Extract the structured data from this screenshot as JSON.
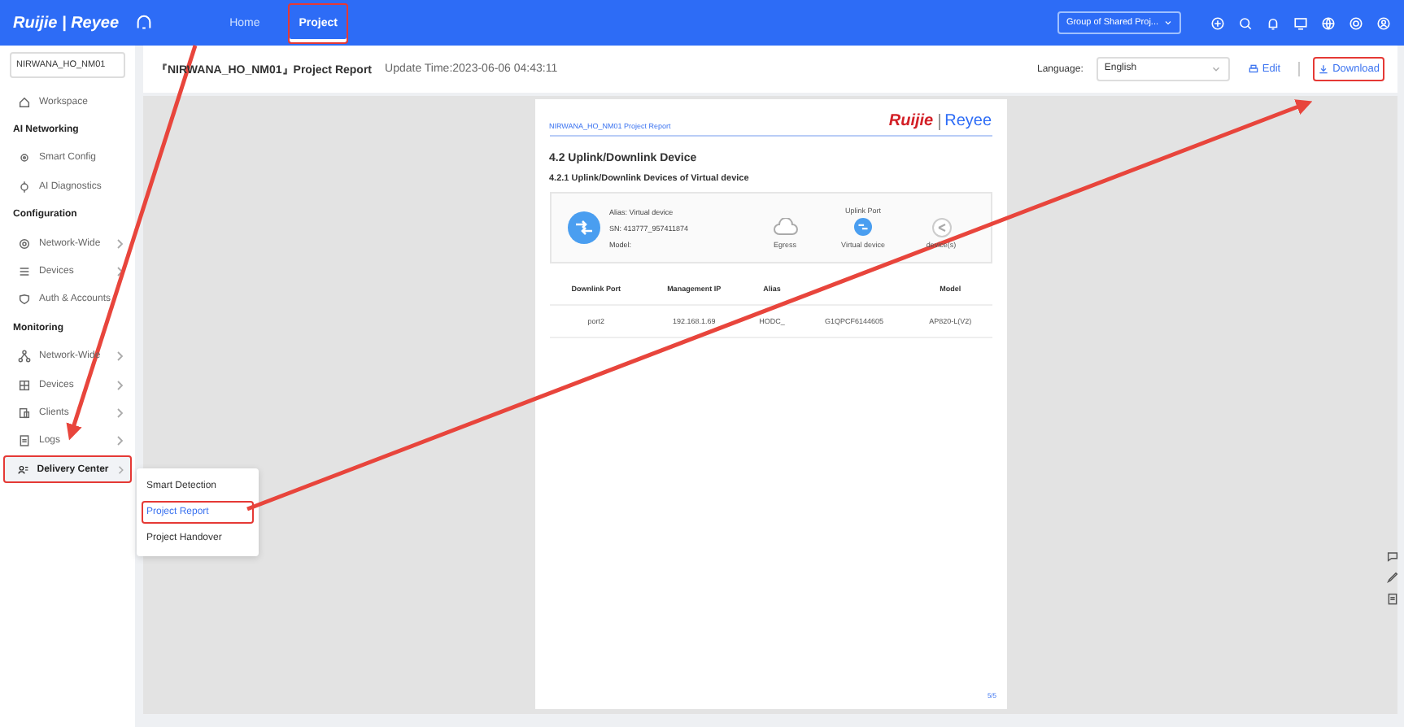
{
  "topbar": {
    "brand": "Ruijie | Reyee",
    "nav": [
      {
        "label": "Home",
        "selected": false,
        "highlighted": false
      },
      {
        "label": "Project",
        "selected": true,
        "highlighted": true
      }
    ],
    "group_select": "Group of Shared Proj..."
  },
  "sidebar": {
    "project_select": "NIRWANA_HO_NM01",
    "items": [
      {
        "kind": "item",
        "label": "Workspace",
        "selected": false,
        "highlighted": false
      },
      {
        "kind": "header",
        "label": "AI Networking"
      },
      {
        "kind": "item",
        "label": "Smart Config",
        "selected": false,
        "highlighted": false
      },
      {
        "kind": "item",
        "label": "AI Diagnostics",
        "selected": false,
        "highlighted": false
      },
      {
        "kind": "header",
        "label": "Configuration"
      },
      {
        "kind": "expandable",
        "label": "Network-Wide",
        "selected": false,
        "highlighted": false
      },
      {
        "kind": "expandable",
        "label": "Devices",
        "selected": false,
        "highlighted": false
      },
      {
        "kind": "item",
        "label": "Auth & Accounts",
        "selected": false,
        "highlighted": false
      },
      {
        "kind": "header",
        "label": "Monitoring"
      },
      {
        "kind": "expandable",
        "label": "Network-Wide",
        "selected": false,
        "highlighted": false
      },
      {
        "kind": "expandable",
        "label": "Devices",
        "selected": false,
        "highlighted": false
      },
      {
        "kind": "expandable",
        "label": "Clients",
        "selected": false,
        "highlighted": false
      },
      {
        "kind": "expandable",
        "label": "Logs",
        "selected": false,
        "highlighted": false
      },
      {
        "kind": "expandable",
        "label": "Delivery Center",
        "selected": true,
        "highlighted": true
      }
    ]
  },
  "submenu": [
    {
      "label": "Smart Detection",
      "selected": false,
      "highlighted": false
    },
    {
      "label": "Project Report",
      "selected": true,
      "highlighted": true
    },
    {
      "label": "Project Handover",
      "selected": false,
      "highlighted": false
    }
  ],
  "header": {
    "title": "『NIRWANA_HO_NM01』Project Report",
    "update_time": "Update Time:2023-06-06 04:43:11",
    "language_label": "Language:",
    "language": "English",
    "edit": "Edit",
    "download": {
      "label": "Download",
      "highlighted": true
    }
  },
  "report": {
    "page_title": "NIRWANA_HO_NM01 Project Report",
    "logo_left": "Ruijie",
    "logo_right": "Reyee",
    "heading": "4.2 Uplink/Downlink Device",
    "subheading": "4.2.1 Uplink/Downlink Devices of Virtual device",
    "device": {
      "alias": "Alias: Virtual device",
      "sn": "SN: 413777_957411874",
      "model": "Model:"
    },
    "topology": {
      "uplink_port": "Uplink Port",
      "egress": "Egress",
      "virtual_device": "Virtual device",
      "lower": "device(s)"
    },
    "columns": [
      "Downlink Port",
      "Management IP",
      "Alias",
      null,
      "Model"
    ],
    "rows": [
      [
        "port2",
        "192.168.1.69",
        "HODC_",
        "G1QPCF6144605",
        "AP820-L(V2)"
      ]
    ],
    "page_number": "5/5"
  }
}
